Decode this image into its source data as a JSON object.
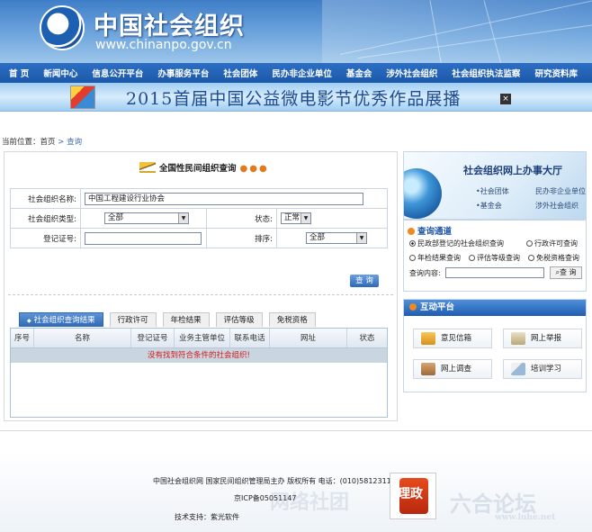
{
  "header": {
    "site_title": "中国社会组织",
    "site_url": "www.chinanpo.gov.cn"
  },
  "nav": {
    "items": [
      "首 页",
      "新闻中心",
      "信息公开平台",
      "办事服务平台",
      "社会团体",
      "民办非企业单位",
      "基金会",
      "涉外社会组织",
      "社会组织执法监察",
      "研究资料库"
    ]
  },
  "banner": {
    "text": "2015首届中国公益微电影节优秀作品展播",
    "close": "×"
  },
  "breadcrumb": {
    "label": "当前位置：",
    "home": "首页",
    "sep": ">",
    "current": "查询"
  },
  "search": {
    "title": "全国性民间组织查询",
    "dots": "●●●",
    "name_label": "社会组织名称:",
    "name_value": "中国工程建设行业协会",
    "type_label": "社会组织类型:",
    "type_value": "全部",
    "status_label": "状态:",
    "status_value": "正常",
    "reg_label": "登记证号:",
    "reg_value": "",
    "sort_label": "排序:",
    "sort_value": "全部",
    "query_button": "查 询"
  },
  "tabs": [
    "社会组织查询结果",
    "行政许可",
    "年检结果",
    "评估等级",
    "免税资格"
  ],
  "results": {
    "columns": [
      "序号",
      "名称",
      "登记证号",
      "业务主管单位",
      "联系电话",
      "网址",
      "状态"
    ],
    "empty_message": "没有找到符合条件的社会组织!"
  },
  "side_banner": {
    "title": "社会组织网上办事大厅",
    "links": [
      "•社会团体",
      "民办非企业单位",
      "•基金会",
      "涉外社会组织"
    ]
  },
  "side_search": {
    "title": "查询通道",
    "options": [
      "民政部登记的社会组织查询",
      "行政许可查询",
      "年检结果查询",
      "评估等级查询",
      "免税资格查询"
    ],
    "input_label": "查询内容:",
    "button": "查 询"
  },
  "interact": {
    "title": "互动平台",
    "buttons": [
      "意见信箱",
      "网上举报",
      "网上调查",
      "培训学习"
    ]
  },
  "footer": {
    "line1": "中国社会组织网  国家民间组织管理局主办  版权所有  电话：(010)58123114",
    "line2": "京ICP备05051147",
    "line3": "技术支持：紫光软件",
    "seal_text": "理政",
    "watermark": "网络社团",
    "watermark2": "六合论坛",
    "watermark2_url": "www.luhe.net"
  },
  "colors": {
    "primary": "#1b58a8",
    "accent": "#f08a1e",
    "error": "#d11a1a"
  }
}
